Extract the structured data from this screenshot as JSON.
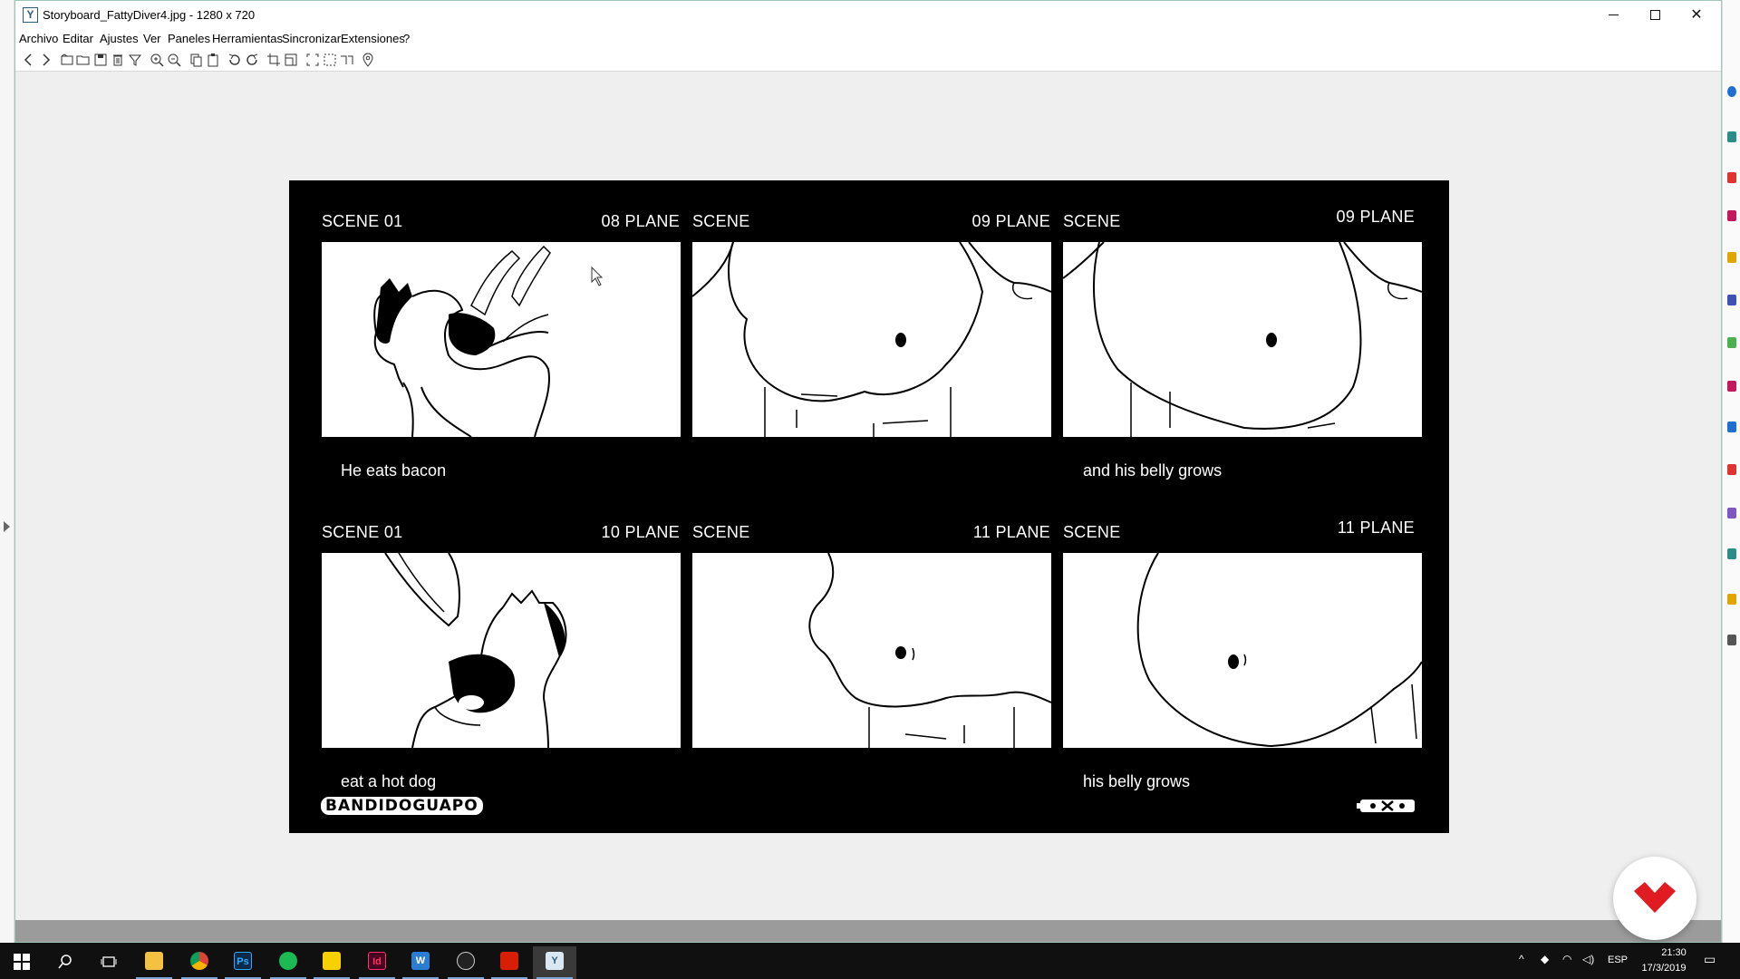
{
  "window": {
    "title": "Storyboard_FattyDiver4.jpg  - 1280 x 720"
  },
  "menu": [
    "Archivo",
    "Editar",
    "Ajustes",
    "Ver",
    "Paneles",
    "Herramientas",
    "Sincronizar",
    "Extensiones",
    "?"
  ],
  "toolbar_icons": [
    "back-arrow-icon",
    "forward-arrow-icon",
    "open-folder-icon",
    "folder-icon",
    "save-icon",
    "delete-icon",
    "filter-icon",
    "zoom-in-icon",
    "zoom-out-icon",
    "copy-icon",
    "paste-icon",
    "rotate-left-icon",
    "rotate-right-icon",
    "crop-icon",
    "resize-icon",
    "select-icon",
    "select-dashed-icon",
    "straighten-icon",
    "location-pin-icon"
  ],
  "storyboard": {
    "panels": [
      {
        "scene": "SCENE 01",
        "plane": "08 PLANE",
        "caption": "He eats bacon"
      },
      {
        "scene": "SCENE",
        "plane": "09 PLANE",
        "caption": ""
      },
      {
        "scene": "SCENE",
        "plane": "09 PLANE",
        "caption": "and his belly grows"
      },
      {
        "scene": "SCENE 01",
        "plane": "10 PLANE",
        "caption": "eat a hot dog"
      },
      {
        "scene": "SCENE",
        "plane": "11 PLANE",
        "caption": ""
      },
      {
        "scene": "SCENE",
        "plane": "11 PLANE",
        "caption": "his belly grows"
      }
    ],
    "logo_text": "BANDIDOGUAPO"
  },
  "taskbar": {
    "apps": [
      "windows-start-icon",
      "search-icon",
      "task-view-icon",
      "file-explorer-icon",
      "chrome-icon",
      "photoshop-icon",
      "spotify-icon",
      "sticky-notes-icon",
      "indesign-icon",
      "word-icon",
      "obs-icon",
      "acrobat-icon",
      "image-viewer-icon"
    ],
    "lang": "ESP",
    "time": "21:30",
    "date": "17/3/2019"
  },
  "colors": {
    "taskbar": "#101010",
    "badge_red": "#e01b22",
    "window_border": "#9ec7b6"
  }
}
